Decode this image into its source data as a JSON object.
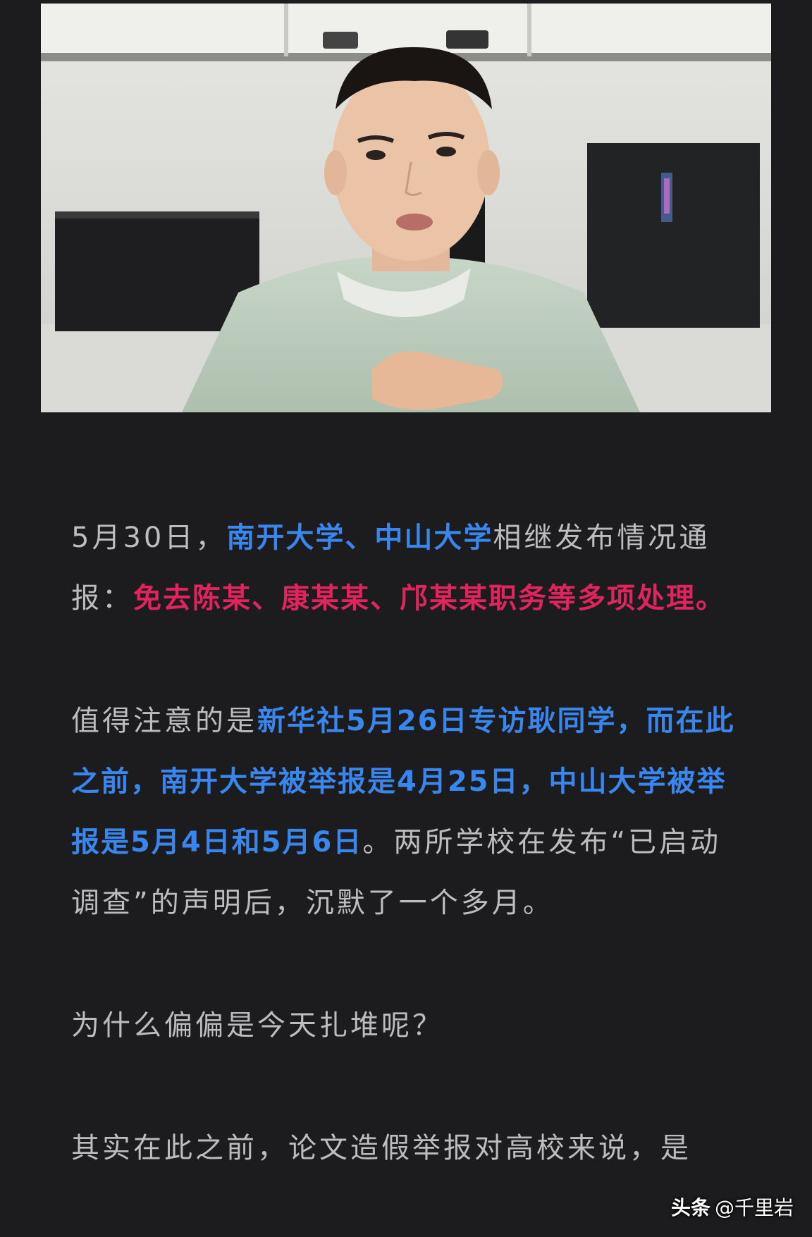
{
  "photo": {
    "alt": "male speaker in light green shirt, hand on chest, in front of white shelves and PC case"
  },
  "article": {
    "p1": {
      "t1": "5月30日，",
      "b1": "南开大学、中山大学",
      "t2": "相继发布情况通报：",
      "r1": "免去陈某、康某某、邝某某职务等多项处理。"
    },
    "p2": {
      "t1": "值得注意的是",
      "b1": "新华社5月26日专访耿同学，而在此之前，南开大学被举报是4月25日，中山大学被举报是5月4日和5月6日",
      "t2": "。两所学校在发布“已启动调查”的声明后，沉默了一个多月。"
    },
    "p3": "为什么偏偏是今天扎堆呢？",
    "p4": "其实在此之前，论文造假举报对高校来说，是"
  },
  "watermark": {
    "brand": "头条",
    "handle": "@千里岩"
  },
  "colors": {
    "background": "#1c1c1e",
    "text": "#bdbdbd",
    "highlight_blue": "#3a86ef",
    "highlight_red": "#e0245e"
  }
}
